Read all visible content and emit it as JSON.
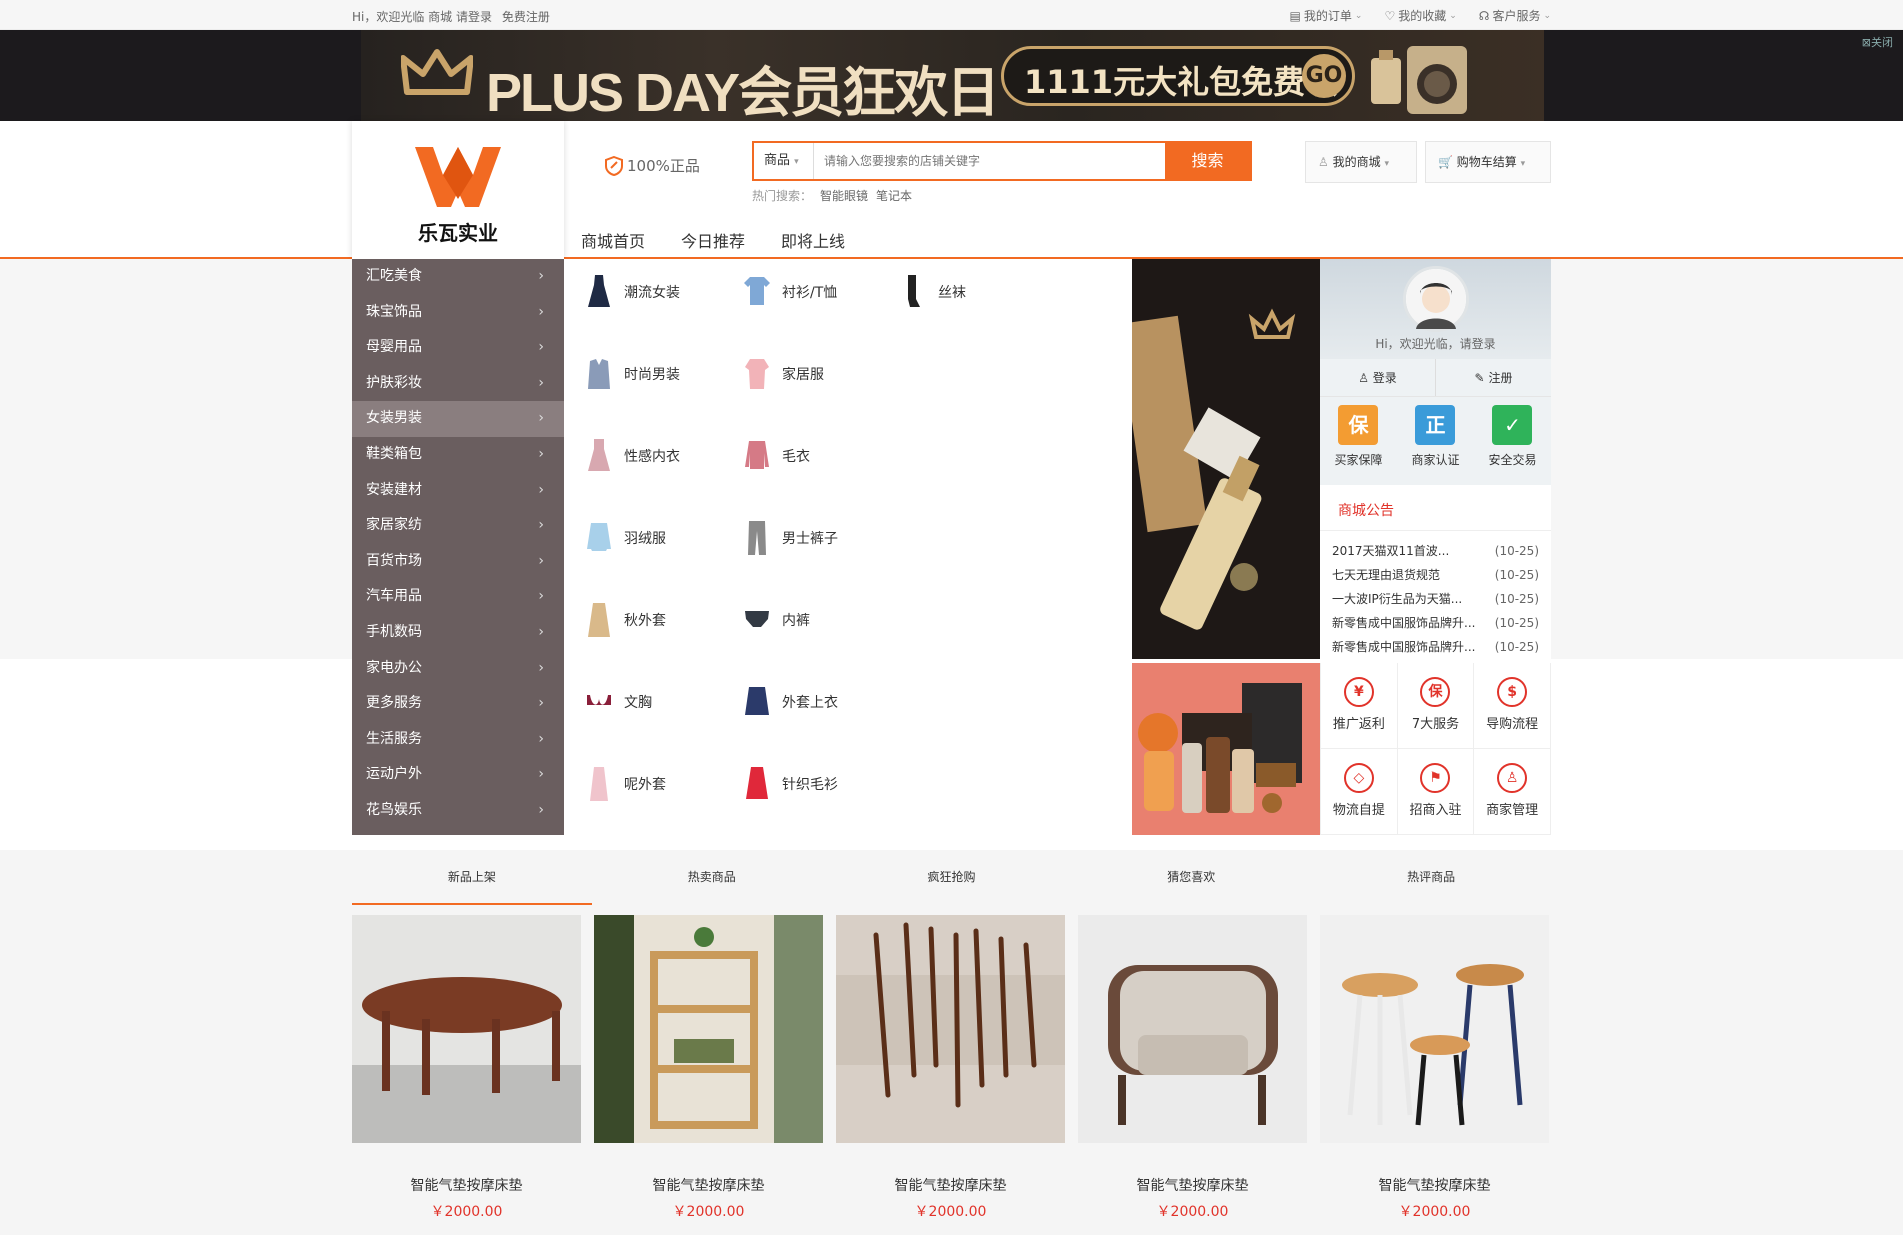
{
  "topbar": {
    "greeting": "Hi，欢迎光临 商城 请登录",
    "register": "免费注册",
    "my_orders": "我的订单",
    "my_favorites": "我的收藏",
    "customer_service": "客户服务"
  },
  "banner": {
    "title": "PLUS DAY会员狂欢日",
    "offer": "1111元大礼包免费领",
    "go": "GO",
    "close": "关闭"
  },
  "logo": {
    "name": "乐瓦实业"
  },
  "header": {
    "genuine": "100%正品",
    "search_category": "商品",
    "search_placeholder": "请输入您要搜索的店铺关键字",
    "search_button": "搜索",
    "hot_label": "热门搜索：",
    "hot_terms": [
      "智能眼镜",
      "笔记本"
    ],
    "my_mall": "我的商城",
    "cart": "购物车结算"
  },
  "nav": {
    "items": [
      "商城首页",
      "今日推荐",
      "即将上线"
    ]
  },
  "categories": [
    "汇吃美食",
    "珠宝饰品",
    "母婴用品",
    "护肤彩妆",
    "女装男装",
    "鞋类箱包",
    "安装建材",
    "家居家纺",
    "百货市场",
    "汽车用品",
    "手机数码",
    "家电办公",
    "更多服务",
    "生活服务",
    "运动户外",
    "花鸟娱乐"
  ],
  "subcategories": [
    {
      "label": "潮流女装",
      "icon": "dress-icon",
      "color": "#1f2a44"
    },
    {
      "label": "衬衫/T恤",
      "icon": "tshirt-icon",
      "color": "#7fa8d6"
    },
    {
      "label": "丝袜",
      "icon": "stockings-icon",
      "color": "#222222"
    },
    {
      "label": "时尚男装",
      "icon": "suit-icon",
      "color": "#8a9bb8"
    },
    {
      "label": "家居服",
      "icon": "homewear-icon",
      "color": "#f2b3b8"
    },
    {
      "label": "性感内衣",
      "icon": "nightdress-icon",
      "color": "#d8a8b0"
    },
    {
      "label": "毛衣",
      "icon": "sweater-icon",
      "color": "#d57a86"
    },
    {
      "label": "羽绒服",
      "icon": "downjacket-icon",
      "color": "#a8d0ea"
    },
    {
      "label": "男士裤子",
      "icon": "trousers-icon",
      "color": "#8a8a8a"
    },
    {
      "label": "秋外套",
      "icon": "trenchcoat-icon",
      "color": "#d9b98a"
    },
    {
      "label": "内裤",
      "icon": "briefs-icon",
      "color": "#333a44"
    },
    {
      "label": "文胸",
      "icon": "bra-icon",
      "color": "#8a1f3a"
    },
    {
      "label": "外套上衣",
      "icon": "jacket-icon",
      "color": "#2b3a6a"
    },
    {
      "label": "呢外套",
      "icon": "woolcoat-icon",
      "color": "#f0c4cc"
    },
    {
      "label": "针织毛衫",
      "icon": "knitwear-icon",
      "color": "#e0283a"
    }
  ],
  "sidebar": {
    "greeting": "Hi，欢迎光临，请登录",
    "login": "登录",
    "register": "注册",
    "badges": [
      {
        "label": "买家保障",
        "glyph": "保",
        "color": "#f39c32"
      },
      {
        "label": "商家认证",
        "glyph": "正",
        "color": "#3a9bd9"
      },
      {
        "label": "安全交易",
        "glyph": "✓",
        "color": "#2fb35a"
      }
    ],
    "notice_title": "商城公告",
    "notices": [
      {
        "title": "2017天猫双11首波...",
        "date": "(10-25)"
      },
      {
        "title": "七天无理由退货规范",
        "date": "(10-25)"
      },
      {
        "title": "一大波IP衍生品为天猫...",
        "date": "(10-25)"
      },
      {
        "title": "新零售成中国服饰品牌升...",
        "date": "(10-25)"
      },
      {
        "title": "新零售成中国服饰品牌升...",
        "date": "(10-25)"
      }
    ],
    "services": [
      {
        "label": "推广返利",
        "glyph": "¥",
        "icon": "rebate-icon"
      },
      {
        "label": "7大服务",
        "glyph": "保",
        "icon": "service-shield-icon"
      },
      {
        "label": "导购流程",
        "glyph": "$",
        "icon": "guide-flow-icon"
      },
      {
        "label": "物流自提",
        "glyph": "◇",
        "icon": "pickup-box-icon"
      },
      {
        "label": "招商入驻",
        "glyph": "⚑",
        "icon": "flag-icon"
      },
      {
        "label": "商家管理",
        "glyph": "♙",
        "icon": "merchant-user-icon"
      }
    ]
  },
  "product_tabs": [
    "新品上架",
    "热卖商品",
    "疯狂抢购",
    "猜您喜欢",
    "热评商品"
  ],
  "products": [
    {
      "name": "智能气垫按摩床垫",
      "price": "￥2000.00",
      "image": "wooden-oval-table"
    },
    {
      "name": "智能气垫按摩床垫",
      "price": "￥2000.00",
      "image": "wooden-bookshelf"
    },
    {
      "name": "智能气垫按摩床垫",
      "price": "￥2000.00",
      "image": "wooden-needles"
    },
    {
      "name": "智能气垫按摩床垫",
      "price": "￥2000.00",
      "image": "armchair"
    },
    {
      "name": "智能气垫按摩床垫",
      "price": "￥2000.00",
      "image": "bar-stools"
    }
  ]
}
